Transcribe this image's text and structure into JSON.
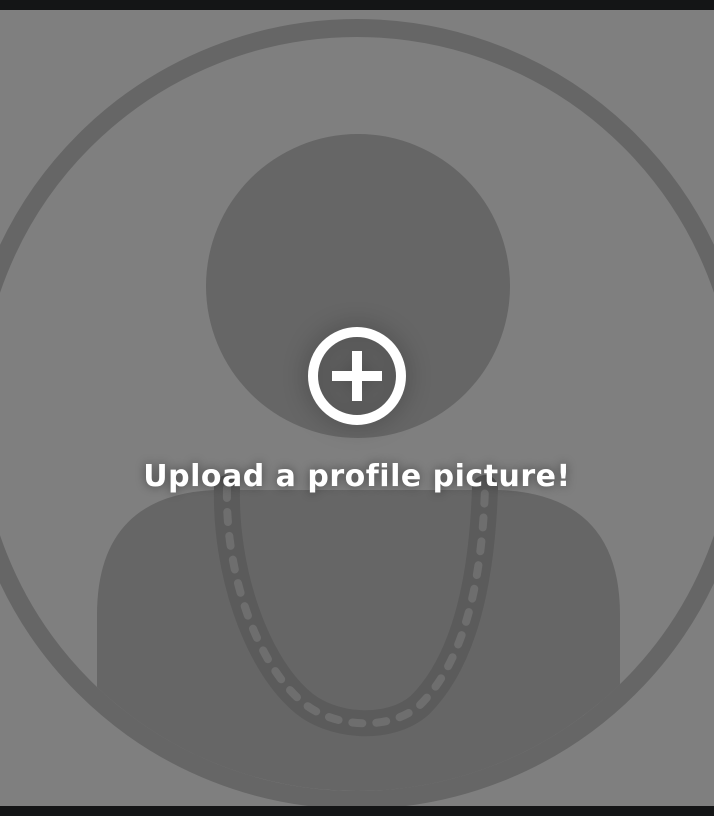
{
  "avatar": {
    "placeholder_icon": "user-silhouette-with-chain-icon",
    "colors": {
      "background": "#7f7f7f",
      "silhouette": "#666666",
      "chain": "#5a5a5a",
      "page_border": "#141516"
    }
  },
  "upload": {
    "icon": "plus-circle-icon",
    "icon_color": "#ffffff",
    "label": "Upload a profile picture!"
  }
}
